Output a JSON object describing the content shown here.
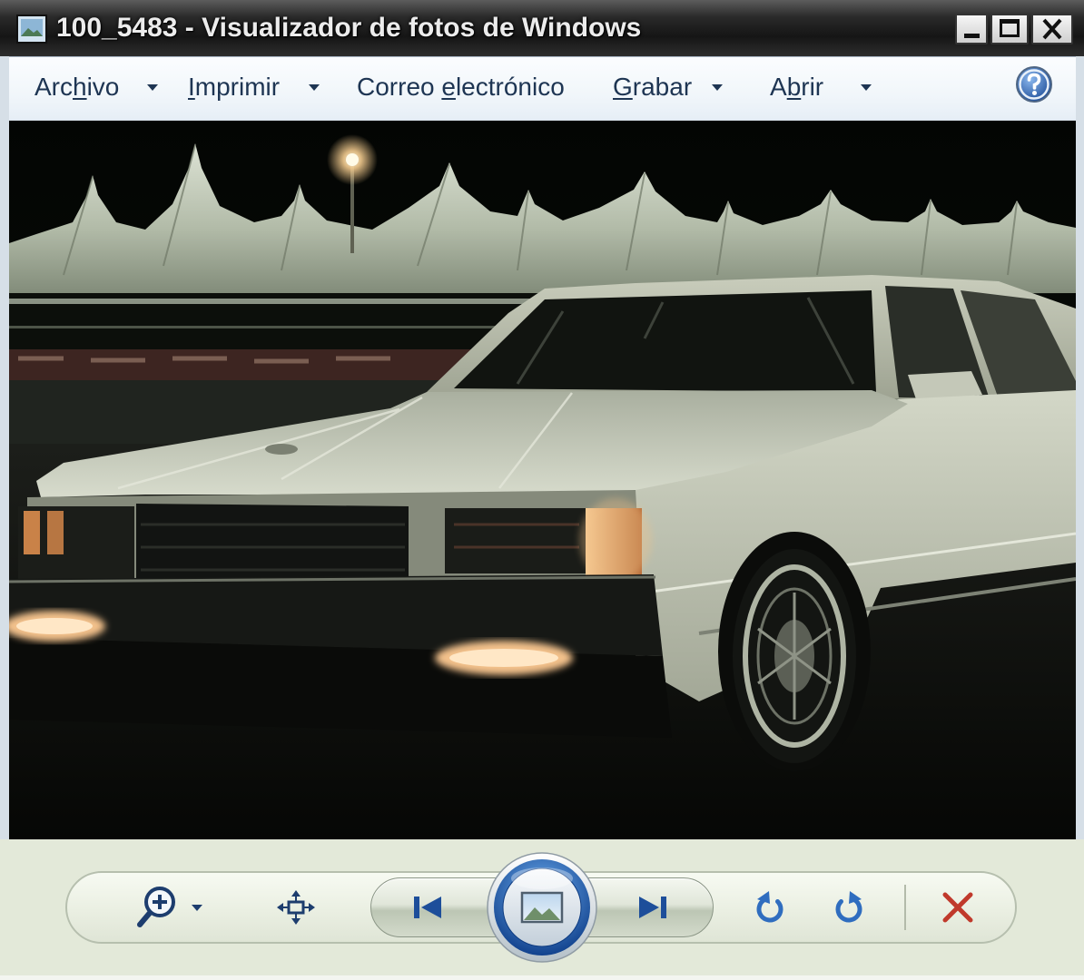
{
  "window": {
    "title": "100_5483 - Visualizador de fotos de Windows",
    "app_icon": "photo-viewer-app-icon"
  },
  "menu": {
    "archivo": {
      "before": "Arc",
      "accel": "h",
      "after": "ivo",
      "has_dropdown": true
    },
    "imprimir": {
      "accel": "I",
      "after": "mprimir",
      "has_dropdown": true
    },
    "correo": {
      "before": "Correo ",
      "accel": "e",
      "after": "lectrónico",
      "has_dropdown": false
    },
    "grabar": {
      "accel": "G",
      "after": "rabar",
      "has_dropdown": true
    },
    "abrir": {
      "before": "A",
      "accel": "b",
      "after": "rir",
      "has_dropdown": true
    },
    "help_icon": "help-icon"
  },
  "toolbar": {
    "icons": [
      "zoom-icon",
      "fit-to-window-icon",
      "previous-icon",
      "slideshow-icon",
      "next-icon",
      "rotate-counterclockwise-icon",
      "rotate-clockwise-icon",
      "delete-icon"
    ]
  },
  "colors": {
    "menu_text": "#1e3553",
    "accent": "#1d4e9a",
    "delete": "#c0392b",
    "title_text": "#ececec",
    "toolbar_bg": "#e3e9d9"
  }
}
